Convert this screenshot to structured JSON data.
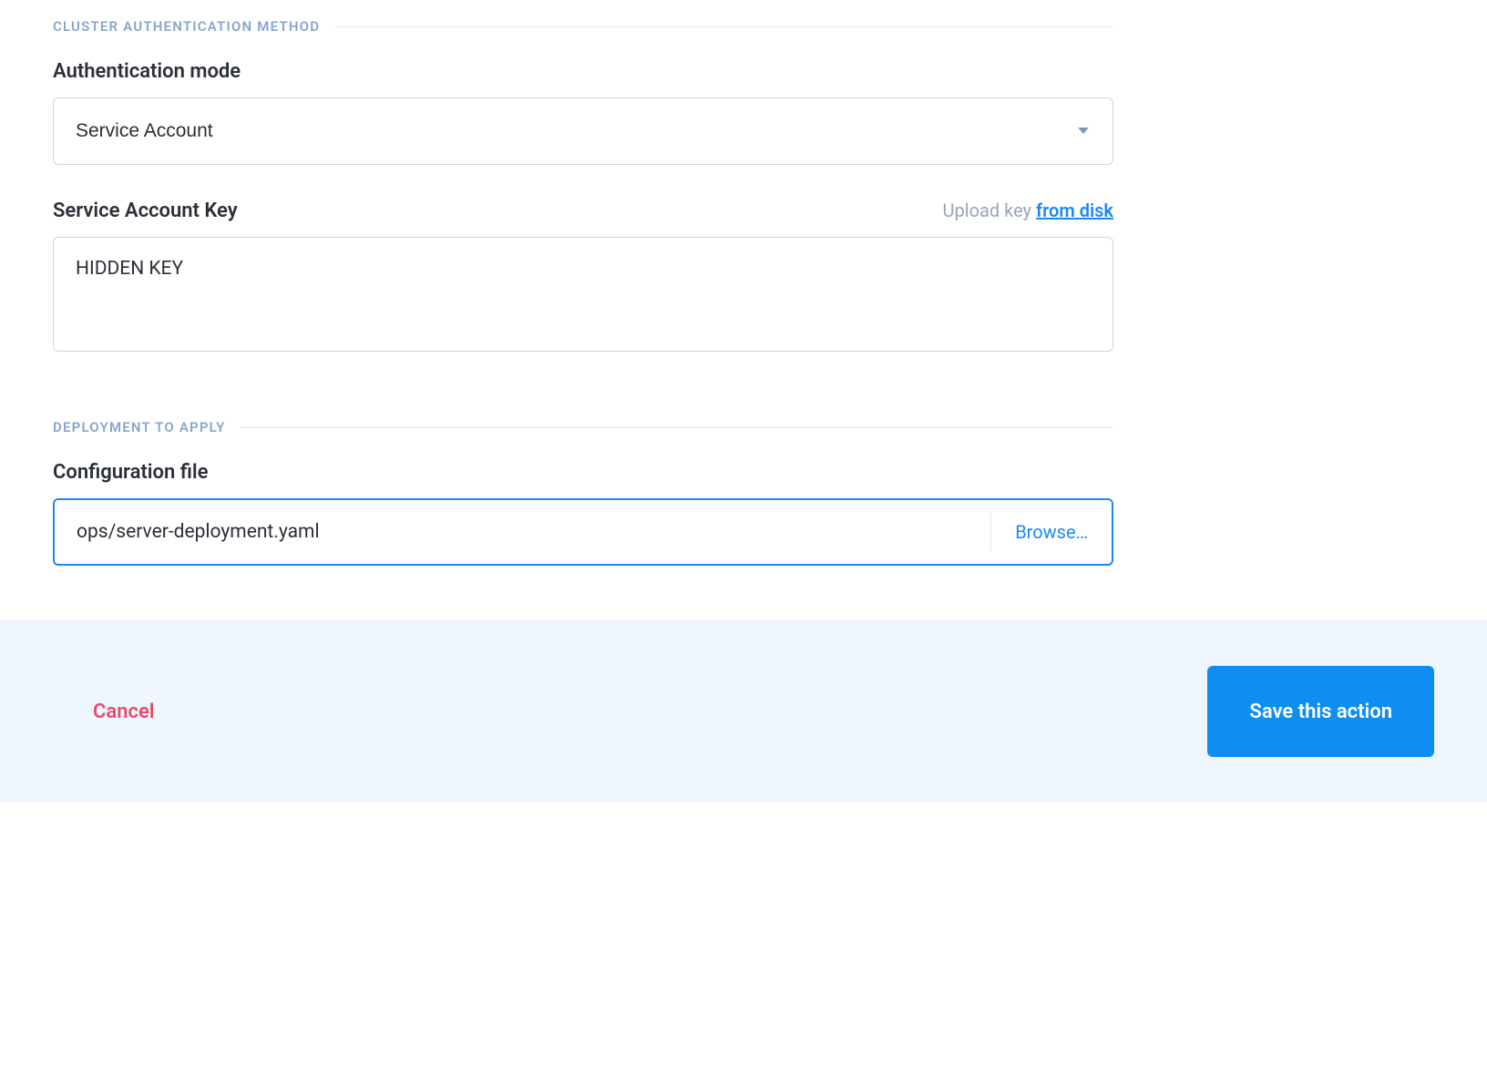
{
  "sections": {
    "auth": {
      "header": "CLUSTER AUTHENTICATION METHOD",
      "mode_label": "Authentication mode",
      "mode_value": "Service Account",
      "key_label": "Service Account Key",
      "key_value": "HIDDEN KEY",
      "upload_text_muted": "Upload key",
      "upload_text_link": "from disk"
    },
    "deployment": {
      "header": "DEPLOYMENT TO APPLY",
      "config_label": "Configuration file",
      "config_value": "ops/server-deployment.yaml",
      "browse_label": "Browse…"
    }
  },
  "footer": {
    "cancel_label": "Cancel",
    "save_label": "Save this action"
  }
}
